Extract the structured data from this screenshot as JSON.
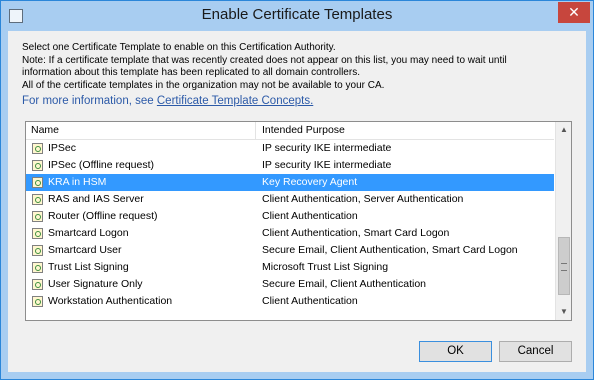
{
  "window": {
    "title": "Enable Certificate Templates",
    "close_label": "✕"
  },
  "intro": {
    "lines": [
      "Select one Certificate Template to enable on this Certification Authority.",
      "Note: If a certificate template that was recently created does not appear on this list, you may need to wait until",
      "information about this template has been replicated to all domain controllers.",
      "All of the certificate templates in the organization may not be available to your CA."
    ],
    "more_info_prefix": "For more information, see",
    "more_info_link": "Certificate Template Concepts."
  },
  "list": {
    "columns": {
      "name": "Name",
      "purpose": "Intended Purpose"
    },
    "rows": [
      {
        "name": "IPSec",
        "purpose": "IP security IKE intermediate",
        "selected": false
      },
      {
        "name": "IPSec (Offline request)",
        "purpose": "IP security IKE intermediate",
        "selected": false
      },
      {
        "name": "KRA in HSM",
        "purpose": "Key Recovery Agent",
        "selected": true
      },
      {
        "name": "RAS and IAS Server",
        "purpose": "Client Authentication, Server Authentication",
        "selected": false
      },
      {
        "name": "Router (Offline request)",
        "purpose": "Client Authentication",
        "selected": false
      },
      {
        "name": "Smartcard Logon",
        "purpose": "Client Authentication, Smart Card Logon",
        "selected": false
      },
      {
        "name": "Smartcard User",
        "purpose": "Secure Email, Client Authentication, Smart Card Logon",
        "selected": false
      },
      {
        "name": "Trust List Signing",
        "purpose": "Microsoft Trust List Signing",
        "selected": false
      },
      {
        "name": "User Signature Only",
        "purpose": "Secure Email, Client Authentication",
        "selected": false
      },
      {
        "name": "Workstation Authentication",
        "purpose": "Client Authentication",
        "selected": false
      }
    ],
    "row_icon": "certificate-template-icon"
  },
  "buttons": {
    "ok": "OK",
    "cancel": "Cancel"
  },
  "colors": {
    "selection": "#3399ff",
    "title_bar": "#a8cdf1",
    "close": "#c7463d",
    "link": "#2c5aa8"
  }
}
